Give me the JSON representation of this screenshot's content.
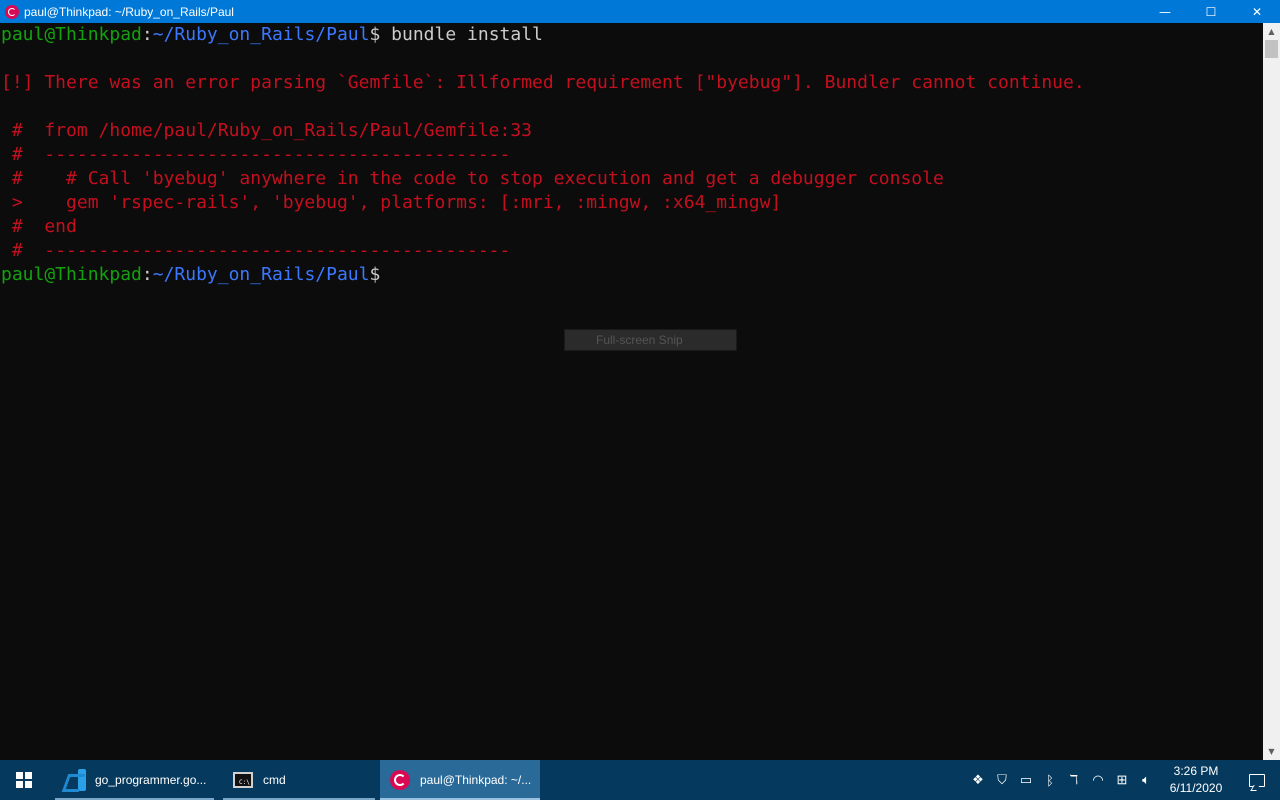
{
  "window": {
    "title": "paul@Thinkpad: ~/Ruby_on_Rails/Paul",
    "controls": {
      "minimize": "—",
      "maximize": "☐",
      "close": "✕"
    }
  },
  "terminal": {
    "prompt_user": "paul@Thinkpad",
    "prompt_sep": ":",
    "prompt_path": "~/Ruby_on_Rails/Paul",
    "prompt_dollar": "$",
    "command": " bundle install",
    "error_lines": [
      "[!] There was an error parsing `Gemfile`: Illformed requirement [\"byebug\"]. Bundler cannot continue.",
      " #  from /home/paul/Ruby_on_Rails/Paul/Gemfile:33",
      " #  -------------------------------------------",
      " #    # Call 'byebug' anywhere in the code to stop execution and get a debugger console",
      " >    gem 'rspec-rails', 'byebug', platforms: [:mri, :mingw, :x64_mingw]",
      " #  end",
      " #  -------------------------------------------"
    ]
  },
  "snip_overlay": {
    "label": "Full-screen Snip"
  },
  "taskbar": {
    "tasks": [
      {
        "label": "go_programmer.go...",
        "icon": "vscode-icon"
      },
      {
        "label": "cmd",
        "icon": "cmd-icon"
      },
      {
        "label": "paul@Thinkpad: ~/...",
        "icon": "debian-icon"
      }
    ],
    "tray_icons": [
      "dropbox-icon",
      "defender-icon",
      "power-icon",
      "bluetooth-icon",
      "pen-icon",
      "wifi-icon",
      "network-icon",
      "volume-icon"
    ],
    "clock": {
      "time": "3:26 PM",
      "date": "6/11/2020"
    }
  }
}
